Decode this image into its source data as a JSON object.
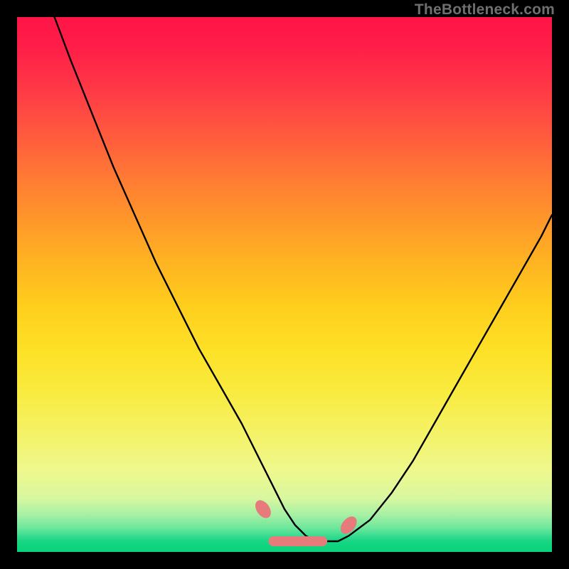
{
  "watermark": "TheBottleneck.com",
  "accent_colors": {
    "curve": "#000000",
    "marker": "#e77a7a",
    "background_black": "#000000"
  },
  "chart_data": {
    "type": "line",
    "title": "",
    "xlabel": "",
    "ylabel": "",
    "xlim": [
      0,
      100
    ],
    "ylim": [
      0,
      100
    ],
    "grid": false,
    "legend": false,
    "series": [
      {
        "name": "bottleneck-curve",
        "x": [
          7,
          10,
          14,
          18,
          22,
          26,
          30,
          34,
          38,
          42,
          46,
          48,
          50,
          52,
          54,
          56,
          58,
          60,
          62,
          66,
          70,
          74,
          78,
          82,
          86,
          90,
          94,
          98,
          100
        ],
        "y": [
          100,
          92,
          82,
          72,
          63,
          54,
          46,
          38,
          31,
          24,
          16,
          12,
          8,
          5,
          3,
          2,
          2,
          2,
          3,
          6,
          11,
          17,
          24,
          31,
          38,
          45,
          52,
          59,
          63
        ]
      }
    ],
    "markers": [
      {
        "name": "bottom-segment",
        "x_start": 47,
        "x_end": 58,
        "y": 2
      },
      {
        "name": "left-blob",
        "x": 46,
        "y": 8
      },
      {
        "name": "right-blob",
        "x": 62,
        "y": 5
      }
    ]
  }
}
